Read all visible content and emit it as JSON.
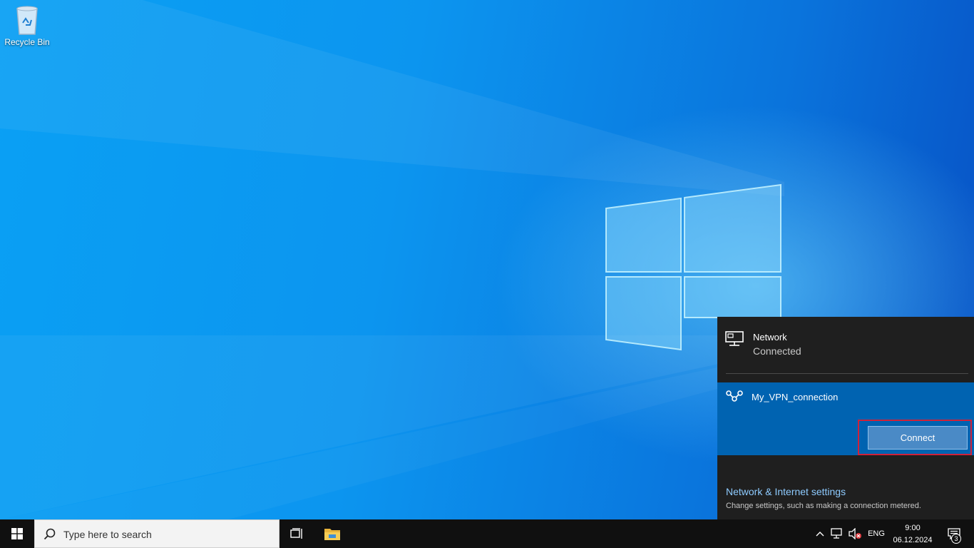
{
  "desktop": {
    "icons": [
      {
        "label": "Recycle Bin",
        "icon": "recycle-bin-icon"
      }
    ]
  },
  "network_flyout": {
    "network": {
      "title": "Network",
      "status": "Connected",
      "icon": "wired-network-icon"
    },
    "vpn": {
      "name": "My_VPN_connection",
      "icon": "vpn-icon",
      "connect_label": "Connect"
    },
    "settings": {
      "link": "Network & Internet settings",
      "description": "Change settings, such as making a connection metered."
    }
  },
  "taskbar": {
    "search_placeholder": "Type here to search",
    "pinned": [
      {
        "name": "Task View",
        "icon": "task-view-icon"
      },
      {
        "name": "File Explorer",
        "icon": "file-explorer-icon"
      }
    ],
    "tray": {
      "language": "ENG",
      "time": "9:00",
      "date": "06.12.2024",
      "notifications_count": "3"
    }
  },
  "colors": {
    "flyout_bg": "#1f1f1f",
    "vpn_selected_bg": "#0063b1",
    "link": "#8ecbff",
    "highlight_border": "#d0213a",
    "taskbar_bg": "#101010"
  }
}
